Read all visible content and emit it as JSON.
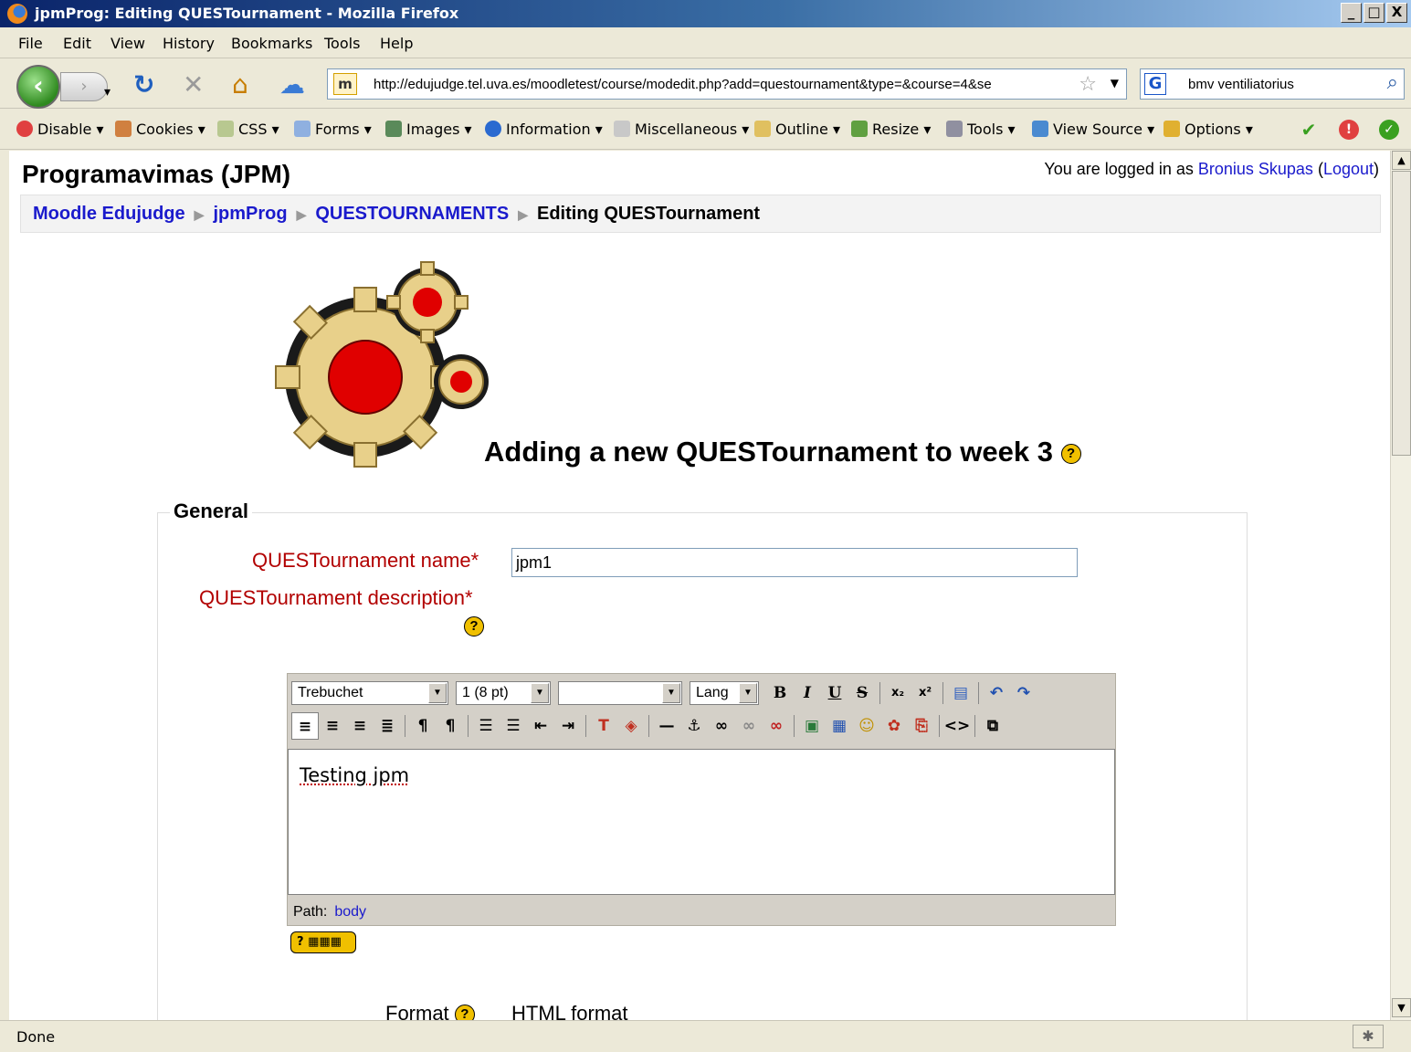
{
  "window": {
    "title": "jpmProg: Editing QUESTournament - Mozilla Firefox",
    "controls": [
      "_",
      "□",
      "X"
    ]
  },
  "menu": [
    "File",
    "Edit",
    "View",
    "History",
    "Bookmarks",
    "Tools",
    "Help"
  ],
  "nav": {
    "url": "http://edujudge.tel.uva.es/moodletest/course/modedit.php?add=questournament&type=&course=4&se",
    "favicon": "m",
    "search_engine": "G",
    "search_text": "bmv ventiliatorius"
  },
  "devbar": {
    "items": [
      "Disable ▾",
      "Cookies ▾",
      "CSS ▾",
      "Forms ▾",
      "Images ▾",
      "Information ▾",
      "Miscellaneous ▾",
      "Outline ▾",
      "Resize ▾",
      "Tools ▾",
      "View Source ▾",
      "Options ▾"
    ]
  },
  "page": {
    "site_name": "Programavimas (JPM)",
    "login_prefix": "You are logged in as ",
    "login_user": "Bronius Skupas",
    "logout": "Logout",
    "breadcrumb": [
      "Moodle Edujudge",
      "jpmProg",
      "QUESTOURNAMENTS",
      "Editing QUESTournament"
    ],
    "heading": "Adding a new QUESTournament to week 3",
    "help_glyph": "?",
    "section": "General",
    "name_label": "QUESTournament name*",
    "name_value": "jpm1",
    "desc_label": "QUESTournament description*",
    "editor": {
      "font": "Trebuchet",
      "size": "1 (8 pt)",
      "style": "",
      "lang": "Lang",
      "content": "Testing jpm",
      "path_label": "Path:",
      "path_value": "body"
    },
    "format_label": "Format",
    "format_value": "HTML format"
  },
  "status": {
    "text": "Done"
  }
}
